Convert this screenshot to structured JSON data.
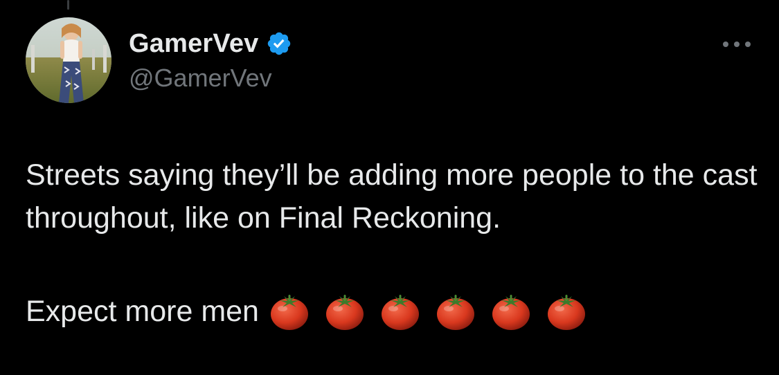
{
  "author": {
    "display_name": "GamerVev",
    "handle": "@GamerVev",
    "verified": true,
    "avatar_icon": "profile-photo"
  },
  "tweet": {
    "text_paragraph_1": "Streets saying they’ll be adding more people to the cast throughout, like on Final Reckoning.",
    "text_paragraph_2": "Expect more men",
    "emoji": [
      "🍅",
      "🍅",
      "🍅",
      "🍅",
      "🍅",
      "🍅"
    ]
  },
  "icons": {
    "verified": "verified-badge-icon",
    "more": "more-options-icon",
    "emoji": "tomato-emoji-icon"
  },
  "colors": {
    "background": "#000000",
    "text_primary": "#e7e9ea",
    "text_secondary": "#71767b",
    "verified_blue": "#1d9bf0",
    "tomato_red": "#d9381e"
  }
}
